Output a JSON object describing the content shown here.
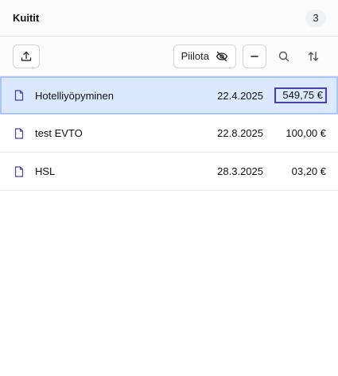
{
  "header": {
    "title": "Kuitit",
    "count": "3"
  },
  "toolbar": {
    "upload_icon": "upload-icon",
    "hide_label": "Piilota",
    "hide_icon": "eye-off-icon",
    "minus_icon": "minus-icon",
    "search_icon": "search-icon",
    "sort_icon": "sort-arrows-icon"
  },
  "receipts": [
    {
      "name": "Hotelliyöpyminen",
      "date": "22.4.2025",
      "amount": "549,75 €",
      "selected": true
    },
    {
      "name": "test EVTO",
      "date": "22.8.2025",
      "amount": "100,00 €",
      "selected": false
    },
    {
      "name": "HSL",
      "date": "28.3.2025",
      "amount": "03,20 €",
      "selected": false
    }
  ],
  "colors": {
    "accent": "#4b3fb0",
    "selected_bg": "#dbe8ff",
    "selected_border": "#a9c6f5"
  }
}
